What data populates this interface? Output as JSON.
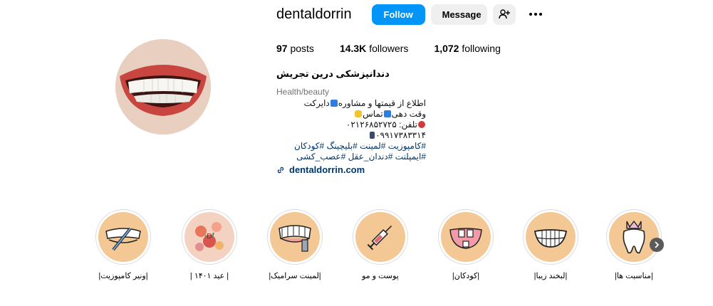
{
  "profile": {
    "username": "dentaldorrin",
    "follow_label": "Follow",
    "message_label": "Message",
    "full_name": "دندانپزشکی درین تجریش",
    "category": "Health/beauty",
    "website": "dentaldorrin.com"
  },
  "stats": {
    "posts_count": "97",
    "posts_label": "posts",
    "followers_count": "14.3K",
    "followers_label": "followers",
    "following_count": "1,072",
    "following_label": "following"
  },
  "bio": {
    "line1": "اطلاع از قیمتها و مشاوره",
    "line1b": "دایرکت",
    "line2": "وقت دهی",
    "line2b": "تماس",
    "line3": "تلفن: ۰۲۱۲۶۸۵۲۷۲۵",
    "line4": "۰۹۹۱۷۳۸۳۳۱۴",
    "line5": "#کامپوزیت #لمینت #بلیچینگ #کودکان",
    "line6": "#ایمپلنت #دندان_عقل #عصب_کشی"
  },
  "highlights": [
    {
      "label": "|ونیر کامپوزیت|",
      "icon": "veneer-tool-icon"
    },
    {
      "label": "| عید ۱۴۰۱ |",
      "icon": "flowers-icon"
    },
    {
      "label": "|لمینت سرامیک|",
      "icon": "laminate-icon"
    },
    {
      "label": "پوست و مو",
      "icon": "syringe-icon"
    },
    {
      "label": "|کودکان|",
      "icon": "kids-teeth-icon"
    },
    {
      "label": "|لبخند زیبا|",
      "icon": "smile-icon"
    },
    {
      "label": "|مناسبت ها|",
      "icon": "crown-tooth-icon"
    }
  ],
  "colors": {
    "accent": "#0095f6",
    "highlight_bg": "#f3c894",
    "link": "#00376b"
  }
}
